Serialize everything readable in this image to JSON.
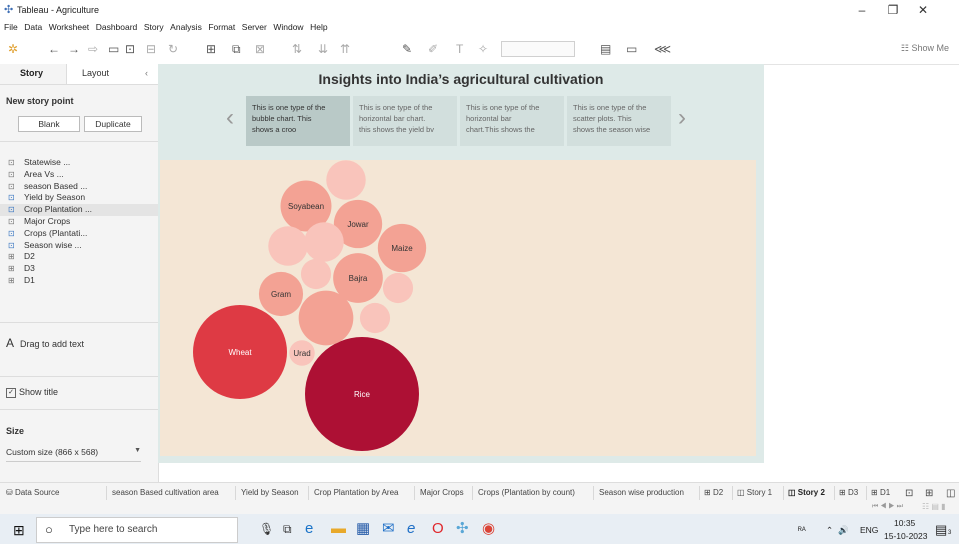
{
  "window": {
    "title": "Tableau - Agriculture",
    "controls": {
      "minimize": "–",
      "maximize": "❐",
      "close": "✕"
    }
  },
  "menu": [
    "File",
    "Data",
    "Worksheet",
    "Dashboard",
    "Story",
    "Analysis",
    "Format",
    "Server",
    "Window",
    "Help"
  ],
  "toolbar": {
    "show_me": "Show Me"
  },
  "sidebar": {
    "tab_story": "Story",
    "tab_layout": "Layout",
    "new_story_point": "New story point",
    "blank_btn": "Blank",
    "duplicate_btn": "Duplicate",
    "sheets": [
      {
        "label": "Statewise ...",
        "icon": "sheet"
      },
      {
        "label": "Area Vs ...",
        "icon": "sheet"
      },
      {
        "label": "season Based ...",
        "icon": "sheet"
      },
      {
        "label": "Yield by Season",
        "icon": "sheet-used"
      },
      {
        "label": "Crop Plantation ...",
        "icon": "sheet-used"
      },
      {
        "label": "Major Crops",
        "icon": "sheet"
      },
      {
        "label": "Crops (Plantati...",
        "icon": "sheet-used"
      },
      {
        "label": "Season wise ...",
        "icon": "sheet-used"
      },
      {
        "label": "D2",
        "icon": "dashboard"
      },
      {
        "label": "D3",
        "icon": "dashboard"
      },
      {
        "label": "D1",
        "icon": "dashboard"
      }
    ],
    "drag_text": "Drag to add text",
    "show_title": "Show title",
    "size_heading": "Size",
    "size_value": "Custom size (866 x 568)"
  },
  "story": {
    "title": "Insights into India’s agricultural cultivation",
    "points": [
      {
        "line1": "This is one type of the",
        "line2": "bubble chart. This",
        "line3": "shows a croo",
        "active": true
      },
      {
        "line1": "This is  one type of the",
        "line2": "horizontal bar chart.",
        "line3": "this shows the yield bv",
        "active": false
      },
      {
        "line1": "This is one type of the",
        "line2": "horizontal bar",
        "line3": "chart.This shows the",
        "active": false
      },
      {
        "line1": "This is  one type of the",
        "line2": "scatter plots. This",
        "line3": "shows the season wise",
        "active": false
      }
    ]
  },
  "chart_data": {
    "type": "bubble",
    "title": "",
    "colors": {
      "light": "#f9c4bb",
      "mid": "#f3a294",
      "dark": "#de3a44",
      "darkest": "#ad1034"
    },
    "bubbles": [
      {
        "label": "Rice",
        "size": 100,
        "color": "#ad1034"
      },
      {
        "label": "Wheat",
        "size": 68,
        "color": "#de3a44"
      },
      {
        "label": "Soyabean",
        "size": 20,
        "color": "#f3a294"
      },
      {
        "label": "Jowar",
        "size": 18,
        "color": "#f3a294"
      },
      {
        "label": "Maize",
        "size": 18,
        "color": "#f3a294"
      },
      {
        "label": "Bajra",
        "size": 19,
        "color": "#f3a294"
      },
      {
        "label": "Gram",
        "size": 15,
        "color": "#f3a294"
      },
      {
        "label": "Urad",
        "size": 5,
        "color": "#f9c4bb"
      },
      {
        "label": "",
        "size": 23,
        "color": "#f3a294"
      },
      {
        "label": "",
        "size": 12,
        "color": "#f9c4bb"
      },
      {
        "label": "",
        "size": 12,
        "color": "#f9c4bb"
      },
      {
        "label": "",
        "size": 12,
        "color": "#f9c4bb"
      },
      {
        "label": "",
        "size": 7,
        "color": "#f9c4bb"
      },
      {
        "label": "",
        "size": 7,
        "color": "#f9c4bb"
      },
      {
        "label": "",
        "size": 7,
        "color": "#f9c4bb"
      }
    ]
  },
  "sheet_tabs": {
    "data_source": "Data Source",
    "tabs": [
      {
        "label": "season Based cultivation area",
        "active": false
      },
      {
        "label": "Yield by Season",
        "active": false
      },
      {
        "label": "Crop Plantation by Area",
        "active": false
      },
      {
        "label": "Major Crops",
        "active": false
      },
      {
        "label": "Crops (Plantation by count)",
        "active": false
      },
      {
        "label": "Season wise production",
        "active": false
      },
      {
        "label": "D2",
        "active": false
      },
      {
        "label": "Story 1",
        "active": false
      },
      {
        "label": "Story 2",
        "active": true
      },
      {
        "label": "D3",
        "active": false
      },
      {
        "label": "D1",
        "active": false
      }
    ]
  },
  "taskbar": {
    "search_placeholder": "Type here to search",
    "lang": "ENG",
    "time": "10:35",
    "date": "15-10-2023",
    "notif_count": "3"
  }
}
